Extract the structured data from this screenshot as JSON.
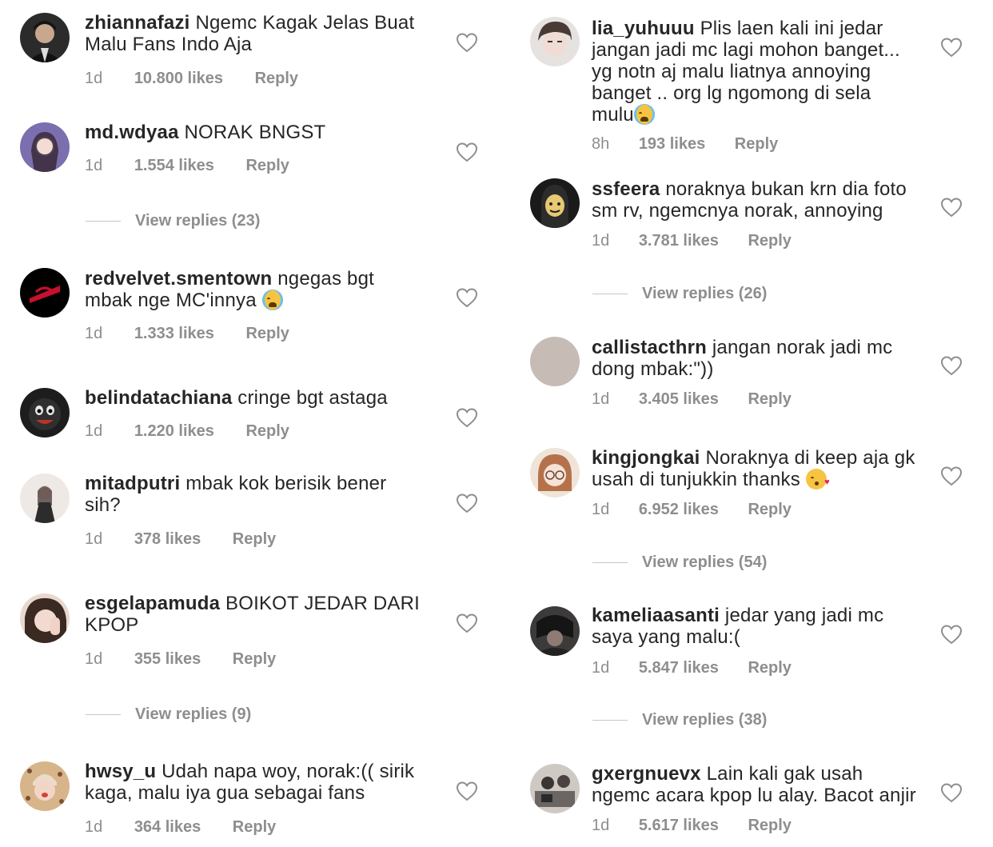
{
  "colors": {
    "text": "#262626",
    "meta": "#8e8e8e",
    "heart": "#8e8e8e",
    "emoji": "#f7c441"
  },
  "labels": {
    "reply": "Reply"
  },
  "left": {
    "comments": [
      {
        "username": "zhiannafazi",
        "text": "Ngemc Kagak Jelas Buat",
        "text2": "Malu Fans Indo Aja",
        "age": "1d",
        "likes": "10.800 likes"
      },
      {
        "username": "md.wdyaa",
        "text": "NORAK BNGST",
        "age": "1d",
        "likes": "1.554 likes"
      },
      {
        "username": "redvelvet.smentown",
        "text": "ngegas bgt",
        "text2": "mbak nge MC'innya",
        "emoji": "loudly-crying-face",
        "age": "1d",
        "likes": "1.333 likes"
      },
      {
        "username": "belindatachiana",
        "text": "cringe bgt astaga",
        "age": "1d",
        "likes": "1.220 likes"
      },
      {
        "username": "mitadputri",
        "text": "mbak kok berisik bener",
        "text2": "sih?",
        "age": "1d",
        "likes": "378 likes"
      },
      {
        "username": "esgelapamuda",
        "text": "BOIKOT JEDAR DARI",
        "text2": "KPOP",
        "age": "1d",
        "likes": "355 likes"
      },
      {
        "username": "hwsy_u",
        "text": "Udah napa woy, norak:(( sirik",
        "text2": "kaga, malu iya gua sebagai fans",
        "age": "1d",
        "likes": "364 likes"
      }
    ],
    "view_replies": [
      "View replies (23)",
      "View replies (9)"
    ]
  },
  "right": {
    "comments": [
      {
        "username": "lia_yuhuuu",
        "text": "Plis laen kali ini jedar",
        "text2": "jangan jadi mc lagi mohon banget...",
        "text3": "yg notn aj malu liatnya annoying",
        "text4": "banget .. org lg ngomong di sela",
        "text5": "mulu",
        "emoji": "loudly-crying-face",
        "age": "8h",
        "likes": "193 likes"
      },
      {
        "username": "ssfeera",
        "text": "noraknya bukan krn dia foto",
        "text2": "sm rv, ngemcnya norak, annoying",
        "age": "1d",
        "likes": "3.781 likes"
      },
      {
        "username": "callistacthrn",
        "text": "jangan norak jadi mc",
        "text2": "dong mbak:\"))",
        "age": "1d",
        "likes": "3.405 likes"
      },
      {
        "username": "kingjongkai",
        "text": "Noraknya di keep aja gk",
        "text2": "usah di tunjukkin thanks",
        "emoji": "face-blowing-kiss",
        "age": "1d",
        "likes": "6.952 likes"
      },
      {
        "username": "kameliaasanti",
        "text": "jedar yang jadi mc",
        "text2": "saya yang malu:(",
        "age": "1d",
        "likes": "5.847 likes"
      },
      {
        "username": "gxergnuevx",
        "text": "Lain kali gak usah",
        "text2": "ngemc acara kpop lu alay. Bacot anjir",
        "age": "1d",
        "likes": "5.617 likes"
      }
    ],
    "view_replies": [
      "View replies (26)",
      "View replies (54)",
      "View replies (38)"
    ]
  },
  "icons": {
    "like": "heart-outline-icon",
    "avatar": "profile-avatar"
  }
}
